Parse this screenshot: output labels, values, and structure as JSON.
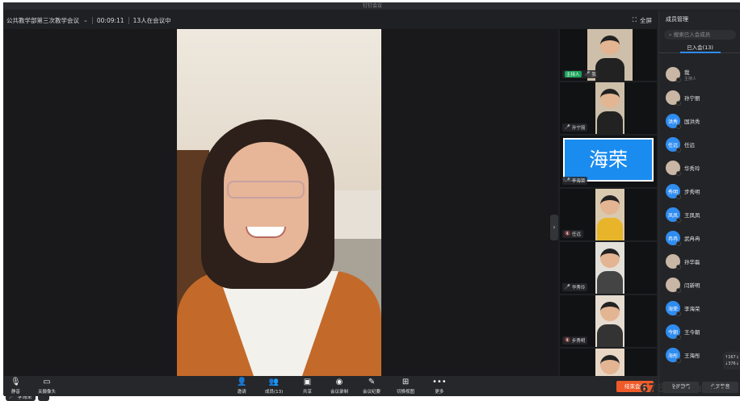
{
  "app": {
    "title": "钉钉会议"
  },
  "meeting": {
    "name": "公共教学部第三次教学会议",
    "duration": "00:09:11",
    "count": "13人在会议中",
    "fullscreen_label": "全屏"
  },
  "main_speaker": {
    "name": "李海荣"
  },
  "tiles": [
    {
      "label": "我",
      "host_badge": "主持人"
    },
    {
      "label": "孙宁丽"
    },
    {
      "label": "李海荣",
      "big_text": "海荣"
    },
    {
      "label": "任远"
    },
    {
      "label": "华秀玲"
    },
    {
      "label": "步秀明"
    }
  ],
  "panel": {
    "title": "成员管理",
    "search_placeholder": "搜索已入会成员",
    "tab_joined": "已入会(13)",
    "members": [
      {
        "name": "我",
        "sub": "主持人",
        "avatar": ""
      },
      {
        "name": "孙宁丽",
        "avatar": ""
      },
      {
        "name": "国洪秀",
        "avatar": "洪秀"
      },
      {
        "name": "任远",
        "avatar": "任远"
      },
      {
        "name": "华秀玲",
        "avatar": ""
      },
      {
        "name": "步秀明",
        "avatar": "秀明"
      },
      {
        "name": "王凤凤",
        "avatar": "凤凤"
      },
      {
        "name": "武冉冉",
        "avatar": "冉冉"
      },
      {
        "name": "孙华磊",
        "avatar": ""
      },
      {
        "name": "闫新明",
        "avatar": ""
      },
      {
        "name": "李海荣",
        "avatar": "海荣"
      },
      {
        "name": "王今朝",
        "avatar": "今朝"
      },
      {
        "name": "王海彤",
        "avatar": "海彤"
      }
    ],
    "btn_left": "全员静音",
    "btn_right": "全员静音"
  },
  "netstat": {
    "up": "↑167↓",
    "down": "↓376↓"
  },
  "toolbar": {
    "mute": "静音",
    "camera": "关摄像头",
    "invite": "邀请",
    "members": "成员(13)",
    "share": "共享",
    "record": "会议录制",
    "minutes": "会议纪要",
    "view": "切换视图",
    "more": "更多",
    "end": "结束会议"
  },
  "watermark": "6789.com.cn",
  "colors": {
    "accent": "#2f8cf0",
    "end": "#f05a28",
    "host": "#1aa35a"
  }
}
